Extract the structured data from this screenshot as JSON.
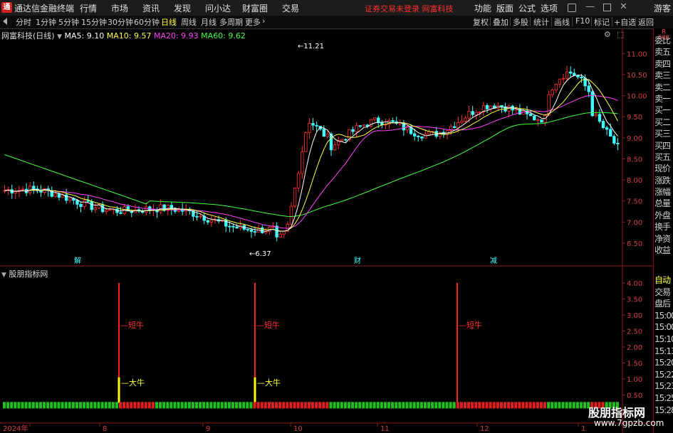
{
  "titlebar": {
    "app_name": "通达信金融终端",
    "menu": [
      "行情",
      "市场",
      "资讯",
      "发现",
      "问小达",
      "财富圈",
      "交易"
    ],
    "notice": "证券交易未登录  网富科技",
    "right_menu": [
      "功能",
      "版面",
      "公式",
      "选项"
    ],
    "guest": "游客"
  },
  "toolbar": {
    "periods": [
      "分时",
      "1分钟",
      "5分钟",
      "15分钟",
      "30分钟",
      "60分钟",
      "日线",
      "周线",
      "月线",
      "多周期",
      "更多"
    ],
    "active_period": "日线",
    "right_buttons": [
      "复权",
      "叠加",
      "多股",
      "统计",
      "画线",
      "F10",
      "标记",
      "+自选",
      "返回"
    ]
  },
  "main_chart": {
    "stock_title": "网富科技(日线)",
    "ma5": "MA5: 9.10",
    "ma10": "MA10: 9.57",
    "ma20": "MA20: 9.93",
    "ma60": "MA60: 9.62",
    "high_label": "11.21",
    "low_label": "6.37",
    "event_labels": [
      "解",
      "财",
      "减"
    ],
    "colors": {
      "ma5": "#ffffff",
      "ma10": "#ffff40",
      "ma20": "#ff40ff",
      "ma60": "#40ff40",
      "up": "#ff3030",
      "down": "#40ffff"
    }
  },
  "price_axis": [
    "11.00",
    "10.50",
    "10.00",
    "9.50",
    "9.00",
    "8.50",
    "8.00",
    "7.50",
    "7.00",
    "6.50"
  ],
  "indicator": {
    "title": "股朋指标网",
    "axis": [
      "4.00",
      "3.50",
      "3.00",
      "2.50",
      "2.00",
      "1.50",
      "1.00",
      "0.50"
    ],
    "signal_short": "短牛",
    "signal_big": "大牛"
  },
  "time_axis": [
    "2024年",
    "8",
    "9",
    "10",
    "11",
    "12",
    "1"
  ],
  "right_panel": {
    "top_labels": [
      "委比",
      "卖五",
      "卖四",
      "卖三",
      "卖二",
      "卖一",
      "买一",
      "买二",
      "买三",
      "买四",
      "买五",
      "现价",
      "涨跌",
      "涨幅",
      "总量",
      "外盘",
      "换手",
      "净资",
      "收益"
    ],
    "bottom_labels": [
      "自动",
      "交易",
      "盘后",
      "15:00",
      "15:00",
      "15:10",
      "15:13",
      "15:20",
      "15:22",
      "15:23",
      "15:25",
      "15:28"
    ],
    "badge": "R 500"
  },
  "watermark": {
    "title": "股朋指标网",
    "url": "www.7gpzb.com"
  }
}
